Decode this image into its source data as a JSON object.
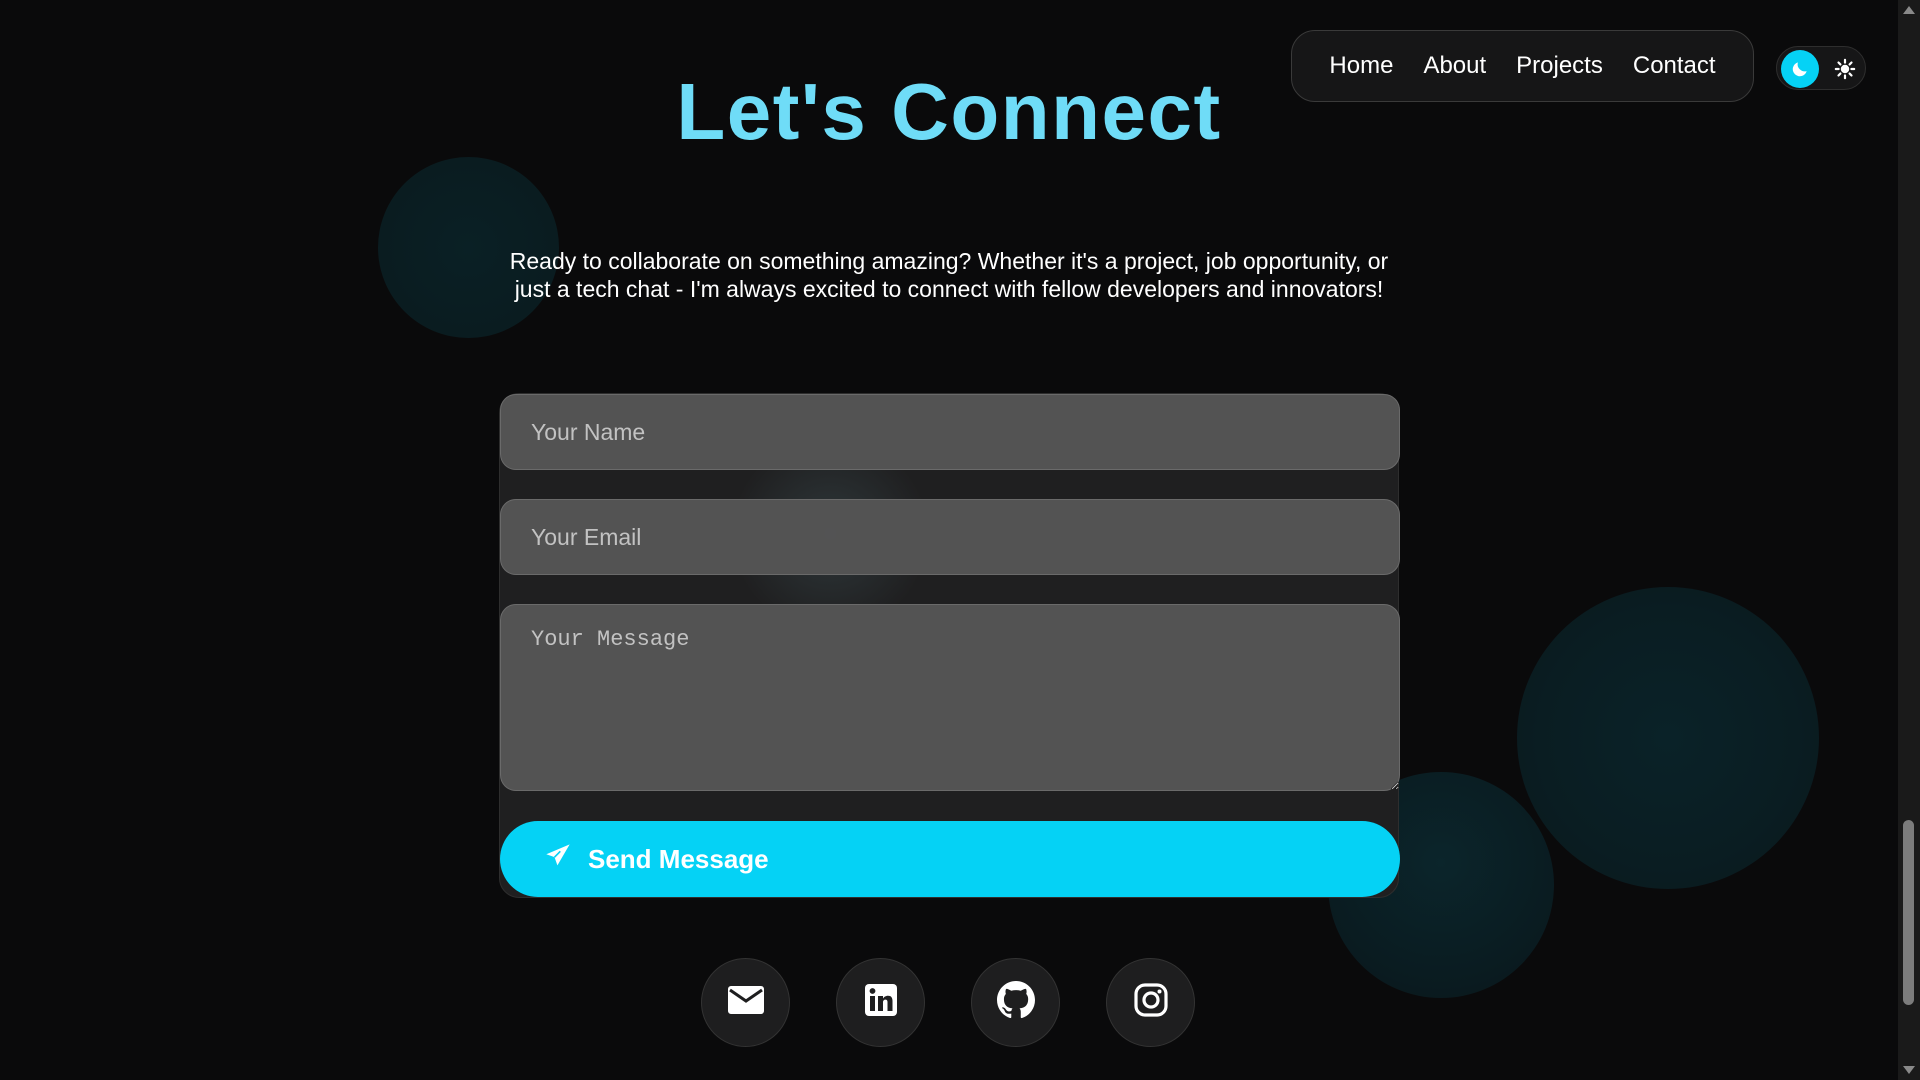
{
  "page": {
    "title": "Let's Connect"
  },
  "nav": {
    "items": [
      "Home",
      "About",
      "Projects",
      "Contact"
    ]
  },
  "theme_toggle": {
    "active": "dark",
    "icons": [
      "moon-icon",
      "sun-icon"
    ]
  },
  "intro": "Ready to collaborate on something amazing? Whether it's a project, job opportunity, or just a tech chat - I'm always excited to connect with fellow developers and innovators!",
  "form": {
    "name_placeholder": "Your Name",
    "email_placeholder": "Your Email",
    "message_placeholder": "Your Message",
    "send_label": "Send Message",
    "send_icon": "paper-plane-icon"
  },
  "social": [
    {
      "icon": "envelope-icon"
    },
    {
      "icon": "linkedin-icon"
    },
    {
      "icon": "github-icon"
    },
    {
      "icon": "instagram-icon"
    }
  ],
  "colors": {
    "accent": "#05d2f5",
    "title": "#6fdcf7",
    "background": "#0a0a0b",
    "card": "#1f1f20",
    "field": "#555555"
  }
}
